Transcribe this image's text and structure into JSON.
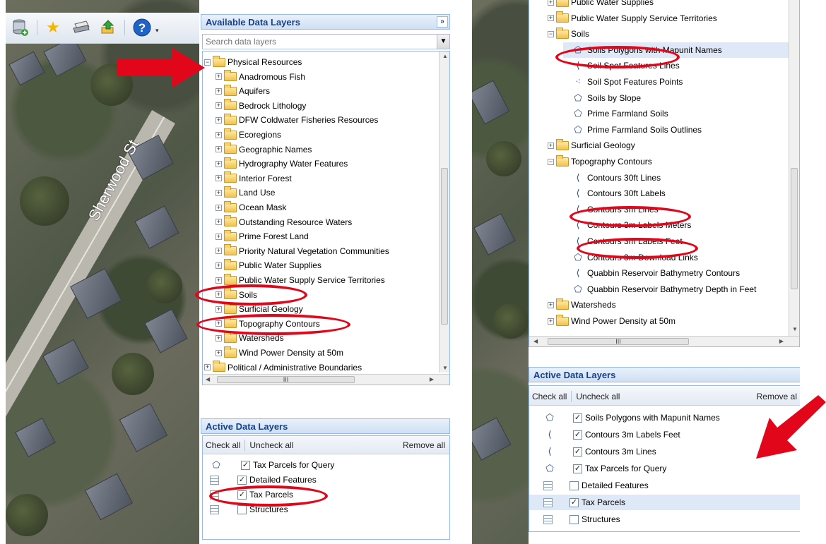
{
  "colors": {
    "annotation_red": "#e2061b",
    "panel_title_blue": "#15428b",
    "selected_row": "#dfe8f6"
  },
  "left": {
    "map": {
      "street_label": "Sherwood St"
    },
    "toolbar": {
      "icons": [
        "add-layer-icon",
        "star-icon",
        "print-icon",
        "upload-icon",
        "help-icon"
      ]
    },
    "available": {
      "title": "Available Data Layers",
      "collapse_label": "»",
      "search_placeholder": "Search data layers",
      "root": "Physical Resources",
      "items": [
        "Anadromous Fish",
        "Aquifers",
        "Bedrock Lithology",
        "DFW Coldwater Fisheries Resources",
        "Ecoregions",
        "Geographic Names",
        "Hydrography Water Features",
        "Interior Forest",
        "Land Use",
        "Ocean Mask",
        "Outstanding Resource Waters",
        "Prime Forest Land",
        "Priority Natural Vegetation Communities",
        "Public Water Supplies",
        "Public Water Supply Service Territories",
        "Soils",
        "Surficial Geology",
        "Topography Contours",
        "Watersheds",
        "Wind Power Density at 50m"
      ],
      "next_root": "Political / Administrative Boundaries",
      "hscroll_thumb": "III"
    },
    "active": {
      "title": "Active Data Layers",
      "check_all": "Check all",
      "uncheck_all": "Uncheck all",
      "remove_all": "Remove all",
      "rows": [
        {
          "label": "Tax Parcels for Query",
          "checked": true,
          "icon": "polygon-icon"
        },
        {
          "label": "Detailed Features",
          "checked": true,
          "icon": "grid-icon"
        },
        {
          "label": "Tax Parcels",
          "checked": true,
          "icon": "grid-icon"
        },
        {
          "label": "Structures",
          "checked": false,
          "icon": "grid-icon"
        }
      ]
    }
  },
  "right": {
    "tree": {
      "rows": [
        "Public Water Supplies",
        "Public Water Supply Service Territories",
        "Soils",
        "Soils Polygons with Mapunit Names",
        "Soil Spot Features Lines",
        "Soil Spot Features Points",
        "Soils by Slope",
        "Prime Farmland Soils",
        "Prime Farmland Soils Outlines",
        "Surficial Geology",
        "Topography Contours",
        "Contours 30ft Lines",
        "Contours 30ft Labels",
        "Contours 3m Lines",
        "Contours 3m Labels Meters",
        "Contours 3m Labels Feet",
        "Contours 3m Download Links",
        "Quabbin Reservoir Bathymetry Contours",
        "Quabbin Reservoir Bathymetry Depth in Feet",
        "Watersheds",
        "Wind Power Density at 50m"
      ],
      "hscroll_thumb": "III"
    },
    "active": {
      "title": "Active Data Layers",
      "check_all": "Check all",
      "uncheck_all": "Uncheck all",
      "remove_all": "Remove al",
      "rows": [
        {
          "label": "Soils Polygons with Mapunit Names",
          "checked": true,
          "icon": "polygon-icon"
        },
        {
          "label": "Contours 3m Labels Feet",
          "checked": true,
          "icon": "line-icon"
        },
        {
          "label": "Contours 3m Lines",
          "checked": true,
          "icon": "line-icon"
        },
        {
          "label": "Tax Parcels for Query",
          "checked": true,
          "icon": "polygon-icon"
        },
        {
          "label": "Detailed Features",
          "checked": false,
          "icon": "grid-icon"
        },
        {
          "label": "Tax Parcels",
          "checked": true,
          "icon": "grid-icon"
        },
        {
          "label": "Structures",
          "checked": false,
          "icon": "grid-icon"
        }
      ]
    }
  }
}
